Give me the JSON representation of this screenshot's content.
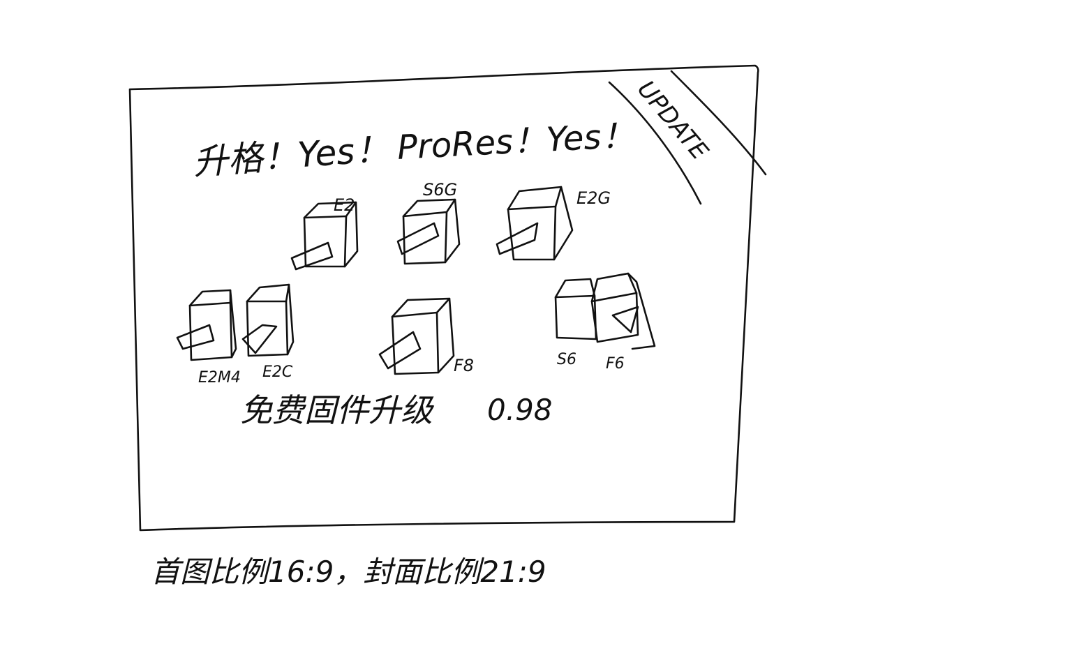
{
  "headline": {
    "upgrade_text": "升格！Yes！",
    "prores_text": "ProRes！Yes！"
  },
  "corner_ribbon": {
    "label": "UPDATE"
  },
  "cameras": {
    "top_row": [
      "E2",
      "S6G",
      "E2G"
    ],
    "bottom_row": [
      "E2M4",
      "E2C",
      "F8",
      "S6",
      "F6"
    ]
  },
  "firmware": {
    "label": "免费固件升级",
    "version": "0.98"
  },
  "footer_note": "首图比例16:9，封面比例21:9"
}
